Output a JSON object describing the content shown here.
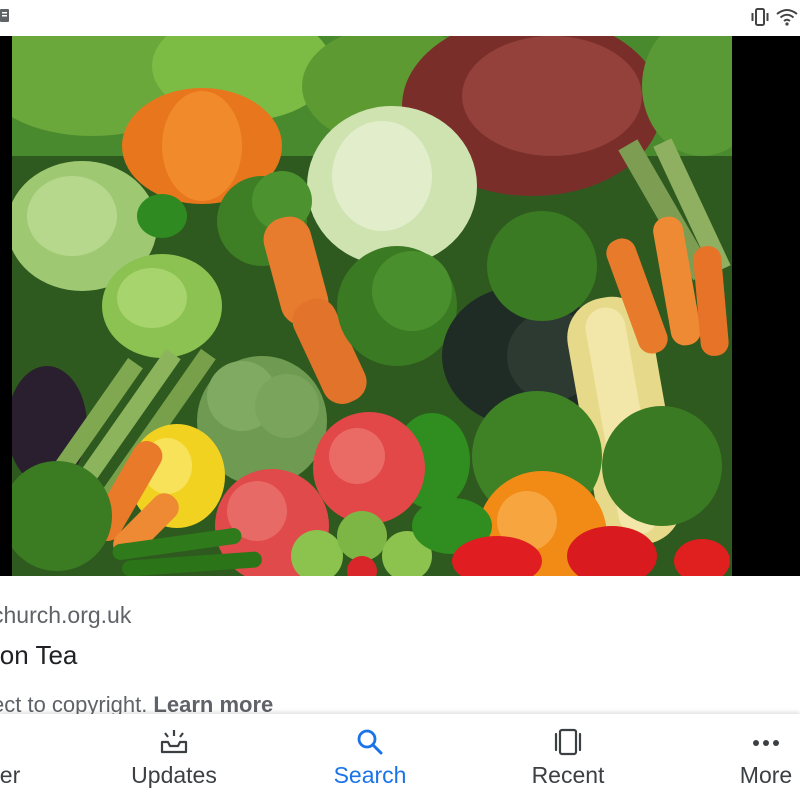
{
  "status_bar": {
    "left_icon": "notification-icon",
    "right_icons": [
      "vibrate-icon",
      "wifi-icon"
    ]
  },
  "image": {
    "subject": "vegetables",
    "alt": ""
  },
  "result": {
    "source": "church.org.uk",
    "title": "ion Tea",
    "copyright_text": "ect to copyright. ",
    "learn_more": "Learn more"
  },
  "bottom_nav": {
    "items": [
      {
        "label": "er",
        "icon": "discover-icon",
        "active": false
      },
      {
        "label": "Updates",
        "icon": "updates-icon",
        "active": false
      },
      {
        "label": "Search",
        "icon": "search-icon",
        "active": true
      },
      {
        "label": "Recent",
        "icon": "recent-icon",
        "active": false
      },
      {
        "label": "More",
        "icon": "more-icon",
        "active": false
      }
    ],
    "active_color": "#1a73e8",
    "inactive_color": "#3c4043"
  }
}
